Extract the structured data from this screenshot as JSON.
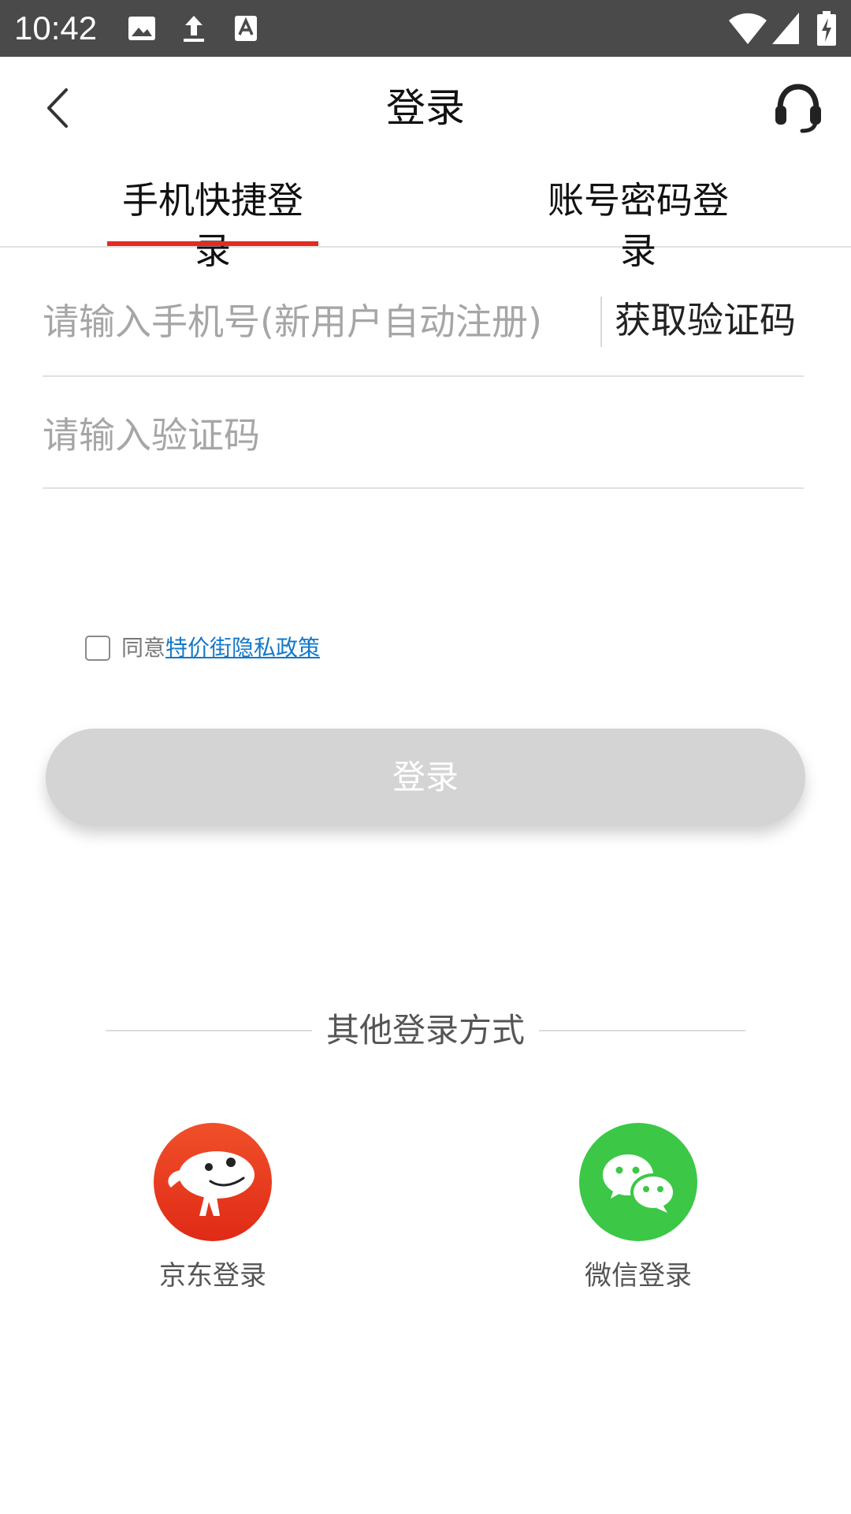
{
  "status_bar": {
    "time": "10:42",
    "left_icons": [
      "image-icon",
      "upload-icon",
      "font-icon"
    ],
    "right_icons": [
      "wifi-icon",
      "signal-icon",
      "battery-charging-icon"
    ]
  },
  "header": {
    "title": "登录",
    "back_icon": "chevron-left-icon",
    "service_icon": "headset-icon"
  },
  "tabs": [
    {
      "label": "手机快捷登录",
      "active": true
    },
    {
      "label": "账号密码登录",
      "active": false
    }
  ],
  "form": {
    "phone_placeholder": "请输入手机号(新用户自动注册)",
    "phone_value": "",
    "get_code_label": "获取验证码",
    "code_placeholder": "请输入验证码",
    "code_value": ""
  },
  "agreement": {
    "checked": false,
    "prefix": "同意",
    "link_text": "特价街隐私政策"
  },
  "login_button_label": "登录",
  "other_login": {
    "title": "其他登录方式",
    "methods": [
      {
        "label": "京东登录",
        "icon": "jd-dog-icon",
        "color": "#e83a20"
      },
      {
        "label": "微信登录",
        "icon": "wechat-icon",
        "color": "#3cc846"
      }
    ]
  },
  "colors": {
    "accent": "#e52a22",
    "link": "#1478c8",
    "button_disabled": "#d4d4d4",
    "status_bar": "#4a4a4a"
  }
}
